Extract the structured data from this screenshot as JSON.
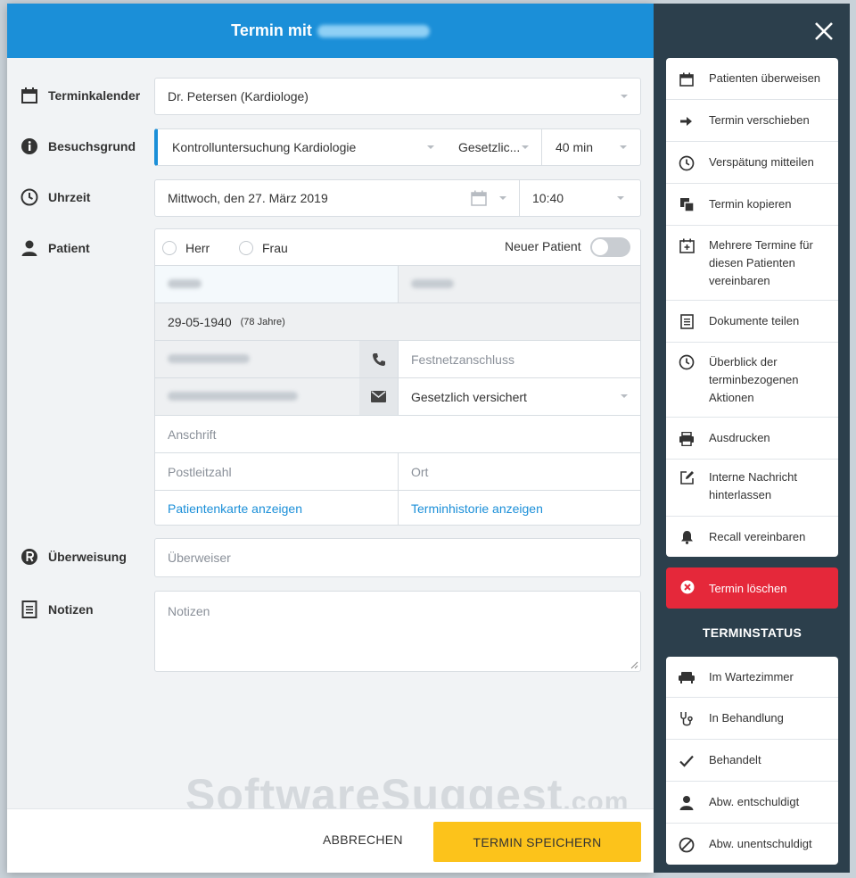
{
  "header": {
    "title": "Termin mit"
  },
  "labels": {
    "calendar": "Terminkalender",
    "reason": "Besuchsgrund",
    "time": "Uhrzeit",
    "patient": "Patient",
    "referral": "Überweisung",
    "notes": "Notizen"
  },
  "calendar": {
    "value": "Dr. Petersen (Kardiologe)"
  },
  "reason": {
    "value": "Kontrolluntersuchung Kardiologie",
    "insurance": "Gesetzlic...",
    "duration": "40 min"
  },
  "time": {
    "date": "Mittwoch, den 27. März 2019",
    "clock": "10:40"
  },
  "patient": {
    "salutation_1": "Herr",
    "salutation_2": "Frau",
    "new_patient_label": "Neuer Patient",
    "new_patient_toggle": false,
    "birthdate": "29-05-1940",
    "age": "(78 Jahre)",
    "landline_placeholder": "Festnetzanschluss",
    "insurance": "Gesetzlich versichert",
    "address_placeholder": "Anschrift",
    "zip_placeholder": "Postleitzahl",
    "city_placeholder": "Ort",
    "card_link": "Patientenkarte anzeigen",
    "history_link": "Terminhistorie anzeigen"
  },
  "referral": {
    "placeholder": "Überweiser"
  },
  "notes": {
    "placeholder": "Notizen"
  },
  "footer": {
    "cancel": "ABBRECHEN",
    "save": "TERMIN SPEICHERN"
  },
  "watermark": {
    "main": "SoftwareSuggest",
    "suffix": ".com"
  },
  "side": {
    "actions": [
      {
        "label": "Patienten überweisen",
        "icon": "calendar-icon"
      },
      {
        "label": "Termin verschieben",
        "icon": "arrow-right-icon"
      },
      {
        "label": "Verspätung mitteilen",
        "icon": "clock-icon"
      },
      {
        "label": "Termin kopieren",
        "icon": "copy-icon"
      },
      {
        "label": "Mehrere Termine für diesen Patienten vereinbaren",
        "icon": "calendar-plus-icon"
      },
      {
        "label": "Dokumente teilen",
        "icon": "document-icon"
      },
      {
        "label": "Überblick der terminbezogenen Aktionen",
        "icon": "clock-icon"
      },
      {
        "label": "Ausdrucken",
        "icon": "printer-icon"
      },
      {
        "label": "Interne Nachricht hinterlassen",
        "icon": "edit-icon"
      },
      {
        "label": "Recall vereinbaren",
        "icon": "bell-icon"
      }
    ],
    "delete_label": "Termin löschen",
    "status_title": "TERMINSTATUS",
    "statuses": [
      {
        "label": "Im Wartezimmer",
        "icon": "sofa-icon"
      },
      {
        "label": "In Behandlung",
        "icon": "stethoscope-icon"
      },
      {
        "label": "Behandelt",
        "icon": "check-icon"
      },
      {
        "label": "Abw. entschuldigt",
        "icon": "person-icon"
      },
      {
        "label": "Abw. unentschuldigt",
        "icon": "ban-icon"
      }
    ]
  }
}
